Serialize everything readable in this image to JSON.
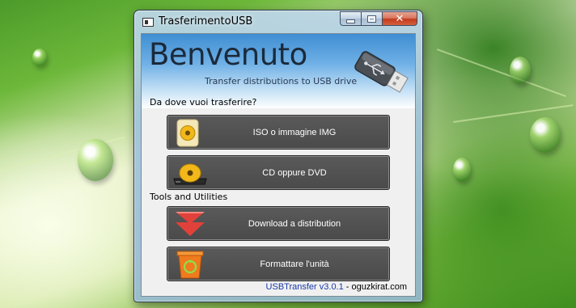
{
  "window": {
    "title": "TrasferimentoUSB",
    "close_glyph": "✕"
  },
  "header": {
    "welcome": "Benvenuto",
    "subtitle": "Transfer distributions to USB drive"
  },
  "sections": {
    "source_label": "Da dove vuoi trasferire?",
    "tools_label": "Tools and Utilities"
  },
  "buttons": {
    "iso": {
      "label": "ISO o immagine IMG",
      "icon": "iso-image-icon"
    },
    "cd": {
      "label": "CD oppure DVD",
      "icon": "cd-dvd-drive-icon"
    },
    "download": {
      "label": "Download a distribution",
      "icon": "download-arrow-icon"
    },
    "format": {
      "label": "Formattare l'unità",
      "icon": "recycle-bin-icon"
    }
  },
  "footer": {
    "version": "USBTransfer v3.0.1",
    "separator": " - ",
    "author": "oguzkirat.com"
  },
  "colors": {
    "button_bg": "#4e4e4e",
    "header_blue": "#3f8ed2",
    "version_link": "#1a3aa8",
    "download_red": "#e0413a",
    "bin_orange": "#f07a1e"
  }
}
